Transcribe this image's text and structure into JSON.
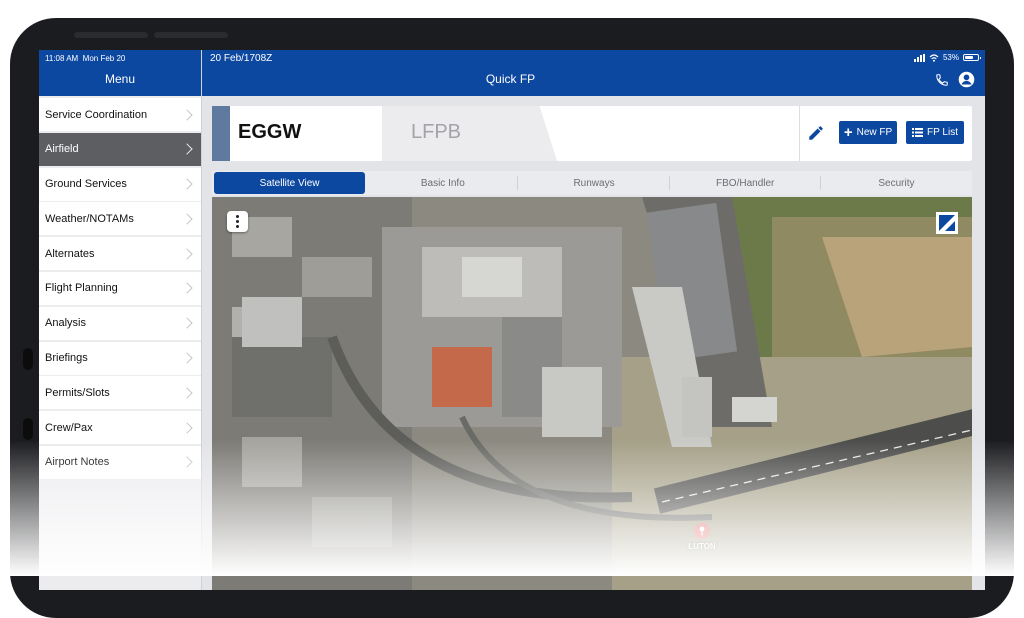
{
  "status_bar": {
    "time": "11:08 AM",
    "date": "Mon Feb 20",
    "battery": "53%"
  },
  "menu": {
    "title": "Menu",
    "items": [
      {
        "label": "Service Coordination",
        "active": false
      },
      {
        "label": "Airfield",
        "active": true
      },
      {
        "label": "Ground Services",
        "active": false
      },
      {
        "label": "Weather/NOTAMs",
        "active": false
      },
      {
        "label": "Alternates",
        "active": false
      },
      {
        "label": "Flight Planning",
        "active": false
      },
      {
        "label": "Analysis",
        "active": false
      },
      {
        "label": "Briefings",
        "active": false
      },
      {
        "label": "Permits/Slots",
        "active": false
      },
      {
        "label": "Crew/Pax",
        "active": false
      },
      {
        "label": "Airport Notes",
        "active": false
      }
    ]
  },
  "header": {
    "datetime": "20 Feb/1708Z",
    "title": "Quick FP",
    "icons": [
      "phone-icon",
      "user-icon"
    ]
  },
  "route": {
    "from": "EGGW",
    "to": "LFPB"
  },
  "actions": {
    "edit_icon": "pencil-icon",
    "new_fp": "New FP",
    "fp_list": "FP List"
  },
  "tabs": [
    {
      "label": "Satellite View",
      "active": true
    },
    {
      "label": "Basic Info",
      "active": false
    },
    {
      "label": "Runways",
      "active": false
    },
    {
      "label": "FBO/Handler",
      "active": false
    },
    {
      "label": "Security",
      "active": false
    }
  ],
  "map": {
    "marker_label": "LUTON",
    "menu_icon": "more-vertical-icon",
    "logo_icon": "map-logo-icon"
  },
  "colors": {
    "primary": "#0d48a0",
    "active_menu": "#5c5e62",
    "stripe": "#5f7a9e"
  }
}
